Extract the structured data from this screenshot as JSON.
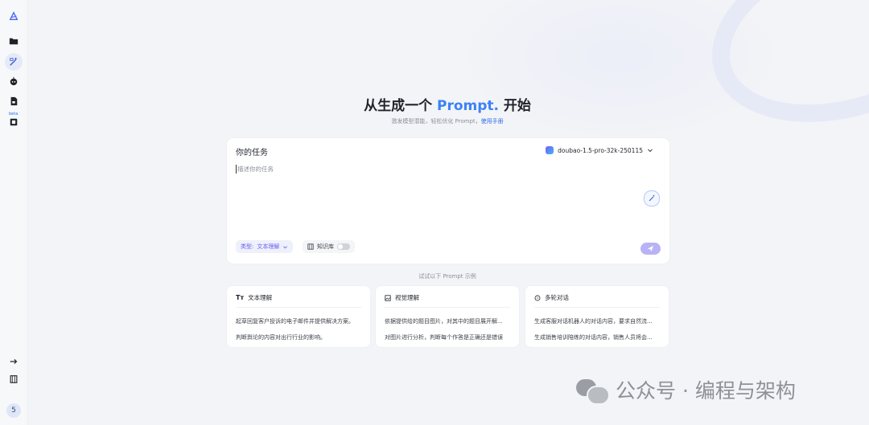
{
  "sidebar": {
    "items": [
      {
        "icon": "folder-icon"
      },
      {
        "icon": "magic-edit-icon",
        "active": true
      },
      {
        "icon": "robot-icon"
      },
      {
        "icon": "document-icon"
      },
      {
        "icon": "beta-lab-icon",
        "badge": "beta"
      }
    ],
    "bottom": [
      {
        "icon": "arrow-right-icon"
      },
      {
        "icon": "book-icon"
      }
    ],
    "avatar_text": "5"
  },
  "hero": {
    "title_prefix": "从生成一个 ",
    "title_accent": "Prompt.",
    "title_suffix": " 开始",
    "subtitle": "激发模型潜能，轻松优化 Prompt，",
    "subtitle_link": "使用手册"
  },
  "task": {
    "title": "你的任务",
    "model": "doubao-1.5-pro-32k-250115",
    "placeholder": "描述你的任务",
    "type_label": "类型:",
    "type_value": "文本理解",
    "knowledge_label": "知识库"
  },
  "examples": {
    "hint": "试试以下 Prompt 示例",
    "cards": [
      {
        "icon": "text-format-icon",
        "title": "文本理解",
        "lines": [
          "起草回复客户投诉的电子邮件并提供解决方案。",
          "判断舆论的内容对出行行业的影响。"
        ]
      },
      {
        "icon": "image-icon",
        "title": "视觉理解",
        "lines": [
          "依据提供给的题目图片，对其中的题目展开解...",
          "对图片进行分析，判断每个作答是正确还是错误"
        ]
      },
      {
        "icon": "chat-icon",
        "title": "多轮对话",
        "lines": [
          "生成客服对话机器人的对话内容，要求自然流...",
          "生成销售培训陪练的对话内容，销售人员将会..."
        ]
      }
    ]
  },
  "watermark": {
    "text": "公众号 · 编程与架构"
  },
  "colors": {
    "accent": "#3b82f6",
    "chip_purple": "#6b5cf0",
    "send": "#b8b2f6"
  }
}
